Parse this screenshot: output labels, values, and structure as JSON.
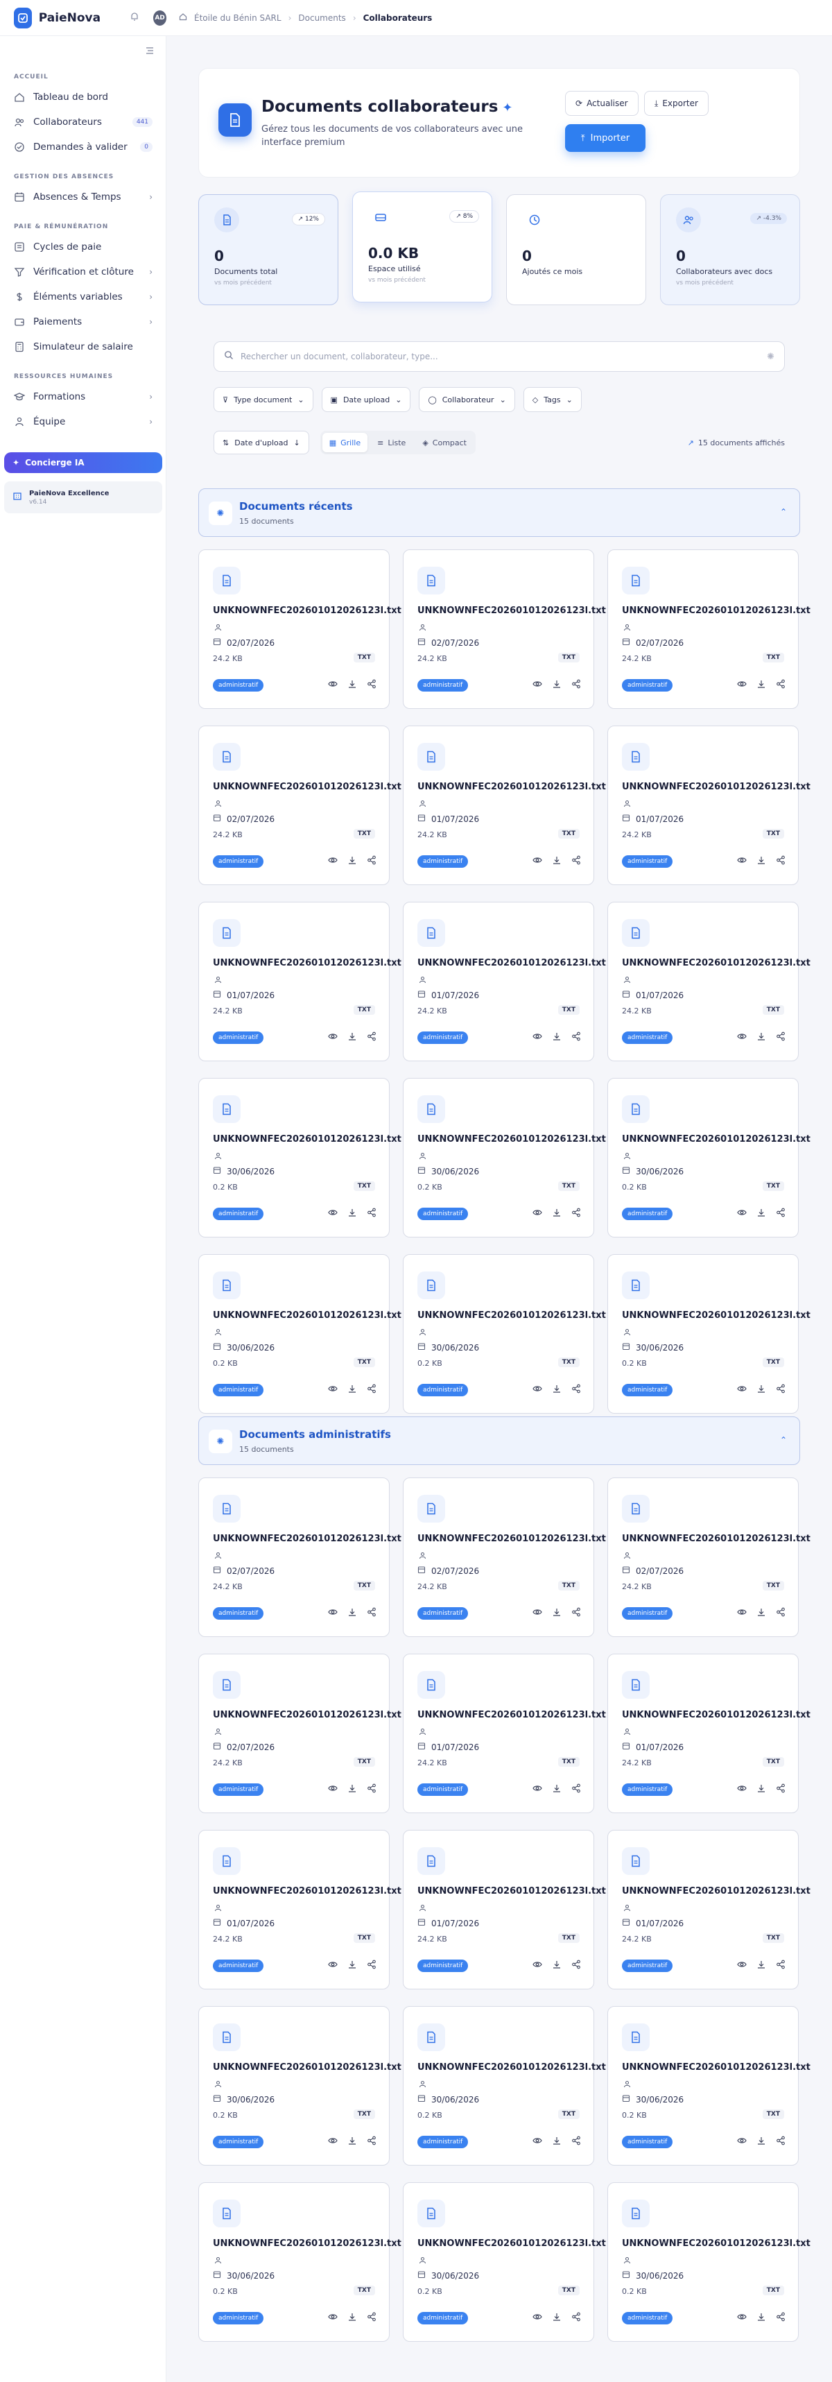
{
  "app": {
    "brand": "PaieNova",
    "avatar": "AD"
  },
  "breadcrumb": [
    "Étoile du Bénin SARL",
    "Documents",
    "Collaborateurs"
  ],
  "sidebar": {
    "sections": [
      {
        "title": "ACCUEIL",
        "items": [
          {
            "label": "Tableau de bord",
            "icon": "home-icon"
          },
          {
            "label": "Collaborateurs",
            "icon": "users-icon",
            "badge": "441"
          },
          {
            "label": "Demandes à valider",
            "icon": "check-circle-icon",
            "badge": "0"
          }
        ]
      },
      {
        "title": "GESTION DES ABSENCES",
        "items": [
          {
            "label": "Absences & Temps",
            "icon": "calendar-icon",
            "chevron": true
          }
        ]
      },
      {
        "title": "PAIE & RÉMUNÉRATION",
        "items": [
          {
            "label": "Cycles de paie",
            "icon": "cycle-icon"
          },
          {
            "label": "Vérification et clôture",
            "icon": "filter-icon",
            "chevron": true
          },
          {
            "label": "Éléments variables",
            "icon": "dollar-icon",
            "chevron": true
          },
          {
            "label": "Paiements",
            "icon": "wallet-icon",
            "chevron": true
          },
          {
            "label": "Simulateur de salaire",
            "icon": "calculator-icon"
          }
        ]
      },
      {
        "title": "RESSOURCES HUMAINES",
        "items": [
          {
            "label": "Formations",
            "icon": "graduation-icon",
            "chevron": true
          },
          {
            "label": "Équipe",
            "icon": "team-icon",
            "chevron": true
          }
        ]
      }
    ],
    "concierge": "Concierge IA",
    "plan": {
      "title": "PaieNova Excellence",
      "version": "v6.14"
    }
  },
  "hero": {
    "title": "Documents collaborateurs",
    "subtitle": "Gérez tous les documents de vos collaborateurs avec une interface premium",
    "refresh": "Actualiser",
    "export": "Exporter",
    "import": "Importer"
  },
  "stats": [
    {
      "value": "0",
      "label": "Documents total",
      "sub": "vs mois précédent",
      "trend": "12%",
      "icon": "document-icon"
    },
    {
      "value": "0.0 KB",
      "label": "Espace utilisé",
      "sub": "vs mois précédent",
      "trend": "8%",
      "icon": "drive-icon"
    },
    {
      "value": "0",
      "label": "Ajoutés ce mois",
      "sub": "",
      "trend": "",
      "icon": "clock-icon"
    },
    {
      "value": "0",
      "label": "Collaborateurs avec docs",
      "sub": "vs mois précédent",
      "trend": "-4.3%",
      "icon": "people-icon"
    }
  ],
  "search": {
    "placeholder": "Rechercher un document, collaborateur, type..."
  },
  "filters": [
    "Type document",
    "Date upload",
    "Collaborateur",
    "Tags"
  ],
  "sort": {
    "label": "Date d'upload"
  },
  "views": [
    "Grille",
    "Liste",
    "Compact"
  ],
  "count": "15 documents affichés",
  "sections": [
    {
      "title": "Documents récents",
      "count": "15 documents"
    },
    {
      "title": "Documents administratifs",
      "count": "15 documents"
    }
  ],
  "documents": [
    {
      "name": "UNKNOWNFEC202601012026123l.txt",
      "date": "02/07/2026",
      "size": "24.2 KB",
      "type": "TXT",
      "tag": "administratif"
    },
    {
      "name": "UNKNOWNFEC202601012026123l.txt",
      "date": "02/07/2026",
      "size": "24.2 KB",
      "type": "TXT",
      "tag": "administratif"
    },
    {
      "name": "UNKNOWNFEC202601012026123l.txt",
      "date": "02/07/2026",
      "size": "24.2 KB",
      "type": "TXT",
      "tag": "administratif"
    },
    {
      "name": "UNKNOWNFEC202601012026123l.txt",
      "date": "02/07/2026",
      "size": "24.2 KB",
      "type": "TXT",
      "tag": "administratif"
    },
    {
      "name": "UNKNOWNFEC202601012026123l.txt",
      "date": "01/07/2026",
      "size": "24.2 KB",
      "type": "TXT",
      "tag": "administratif"
    },
    {
      "name": "UNKNOWNFEC202601012026123l.txt",
      "date": "01/07/2026",
      "size": "24.2 KB",
      "type": "TXT",
      "tag": "administratif"
    },
    {
      "name": "UNKNOWNFEC202601012026123l.txt",
      "date": "01/07/2026",
      "size": "24.2 KB",
      "type": "TXT",
      "tag": "administratif"
    },
    {
      "name": "UNKNOWNFEC202601012026123l.txt",
      "date": "01/07/2026",
      "size": "24.2 KB",
      "type": "TXT",
      "tag": "administratif"
    },
    {
      "name": "UNKNOWNFEC202601012026123l.txt",
      "date": "01/07/2026",
      "size": "24.2 KB",
      "type": "TXT",
      "tag": "administratif"
    },
    {
      "name": "UNKNOWNFEC202601012026123l.txt",
      "date": "30/06/2026",
      "size": "0.2 KB",
      "type": "TXT",
      "tag": "administratif"
    },
    {
      "name": "UNKNOWNFEC202601012026123l.txt",
      "date": "30/06/2026",
      "size": "0.2 KB",
      "type": "TXT",
      "tag": "administratif"
    },
    {
      "name": "UNKNOWNFEC202601012026123l.txt",
      "date": "30/06/2026",
      "size": "0.2 KB",
      "type": "TXT",
      "tag": "administratif"
    },
    {
      "name": "UNKNOWNFEC202601012026123l.txt",
      "date": "30/06/2026",
      "size": "0.2 KB",
      "type": "TXT",
      "tag": "administratif"
    },
    {
      "name": "UNKNOWNFEC202601012026123l.txt",
      "date": "30/06/2026",
      "size": "0.2 KB",
      "type": "TXT",
      "tag": "administratif"
    },
    {
      "name": "UNKNOWNFEC202601012026123l.txt",
      "date": "30/06/2026",
      "size": "0.2 KB",
      "type": "TXT",
      "tag": "administratif"
    }
  ]
}
